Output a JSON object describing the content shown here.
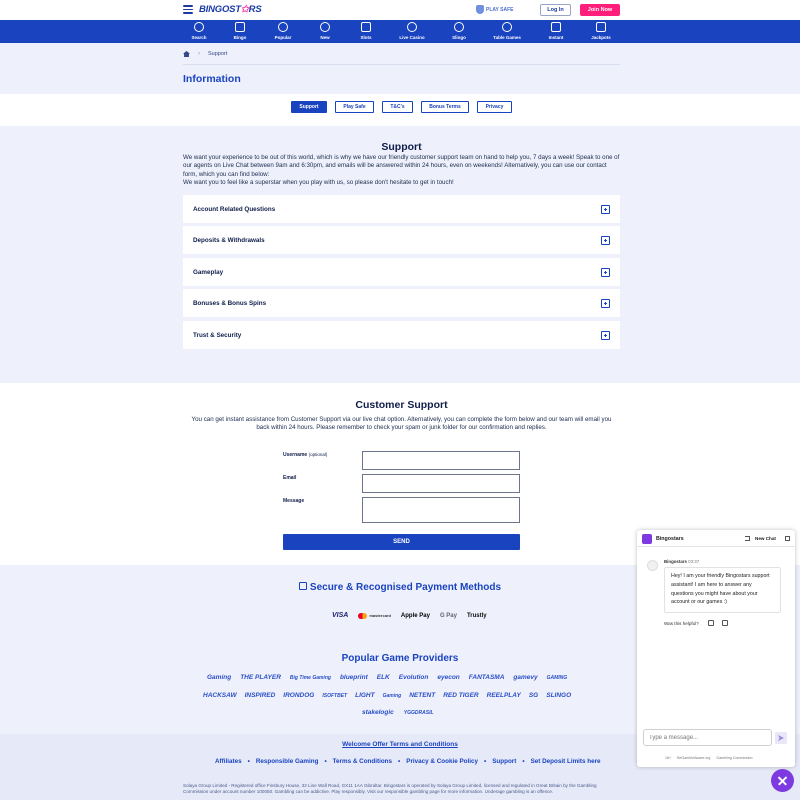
{
  "header": {
    "logo_text_a": "BINGOST",
    "logo_star": "✩",
    "logo_text_b": "RS",
    "play_safe": "PLAY SAFE",
    "login": "Log In",
    "join": "Join Now"
  },
  "nav": [
    {
      "label": "Search",
      "icon": "search-icon"
    },
    {
      "label": "Bingo",
      "icon": "bingo-icon"
    },
    {
      "label": "Popular",
      "icon": "flame-icon"
    },
    {
      "label": "New",
      "icon": "new-icon"
    },
    {
      "label": "Slots",
      "icon": "slots-icon"
    },
    {
      "label": "Live Casino",
      "icon": "live-casino-icon"
    },
    {
      "label": "Slingo",
      "icon": "slingo-icon"
    },
    {
      "label": "Table Games",
      "icon": "table-games-icon"
    },
    {
      "label": "Instant",
      "icon": "instant-icon"
    },
    {
      "label": "Jackpots",
      "icon": "jackpots-icon"
    }
  ],
  "breadcrumb": {
    "sep": "›",
    "current": "Support"
  },
  "page_title": "Information",
  "tabs": [
    "Support",
    "Play Safe",
    "T&C's",
    "Bonus Terms",
    "Privacy"
  ],
  "support": {
    "title": "Support",
    "line1": "We want your experience to be out of this world, which is why we have our friendly customer support team on hand to help you, 7 days a week! Speak to one of our agents on Live Chat between 9am and 6:30pm, and emails will be answered within 24 hours, even on weekends! Alternatively, you can use our contact form, which you can find below:",
    "line2": "We want you to feel like a superstar when you play with us, so please don't hesitate to get in touch!"
  },
  "faq": [
    "Account Related Questions",
    "Deposits & Withdrawals",
    "Gameplay",
    "Bonuses & Bonus Spins",
    "Trust & Security"
  ],
  "customer_support": {
    "title": "Customer Support",
    "text": "You can get instant assistance from Customer Support via our live chat option. Alternatively, you can complete the form below and our team will email you back within 24 hours. Please remember to check your spam or junk folder for our confirmation and replies."
  },
  "form": {
    "username_label": "Username",
    "username_optional": "(optional)",
    "email_label": "Email",
    "message_label": "Message",
    "send": "SEND"
  },
  "payments": {
    "title": "Secure & Recognised Payment Methods",
    "logos": [
      "VISA",
      "mastercard",
      "Apple Pay",
      "G Pay",
      "Trustly"
    ]
  },
  "providers": {
    "title": "Popular Game Providers",
    "row1": [
      "Gaming",
      "THE PLAYER",
      "Big Time Gaming",
      "blueprint",
      "ELK",
      "Evolution",
      "eyecon",
      "FANTASMA",
      "gamevy",
      "GAMING"
    ],
    "row2": [
      "HACKSAW",
      "INSPIRED",
      "IRONDOG",
      "ISOFTBET",
      "LIGHT",
      "Gaming",
      "NETENT",
      "RED TIGER",
      "REELPLAY",
      "SG",
      "SLINGO"
    ],
    "row3": [
      "stakelogic",
      "YGGDRASIL"
    ]
  },
  "footer": {
    "welcome": "Welcome Offer Terms and Conditions",
    "links": [
      "Affiliates",
      "Responsible Gaming",
      "Terms & Conditions",
      "Privacy & Cookie Policy",
      "Support",
      "Set Deposit Limits here"
    ],
    "dot": "•",
    "legal": "Solaya Group Limited - Registered office Finsbury House, 32 Line Wall Road, GX11 1AA Gibraltar. Bingostars is operated by Solaya Group Limited, licensed and regulated in Great Britain by the Gambling Commission under account number 100050. Gambling can be addictive. Play responsibly. Visit our responsible gambling page for more information. Underage gambling is an offence."
  },
  "chat": {
    "name": "Bingostars",
    "new_chat": "New Chat",
    "bot_name": "Bingostars",
    "bot_time": "03:37",
    "message": "Hey! I am your friendly Bingostars support assistant! I am here to answer any questions you might have about your account or our games :)",
    "helpful": "Was this helpful?",
    "input_placeholder": "Type a message...",
    "footer": [
      "18+",
      "BeGambleAware.org",
      "Gambling Commission"
    ]
  },
  "colors": {
    "brand_blue": "#1a43bf",
    "pink": "#ff1f7a",
    "chat_purple": "#7c3ae0"
  }
}
